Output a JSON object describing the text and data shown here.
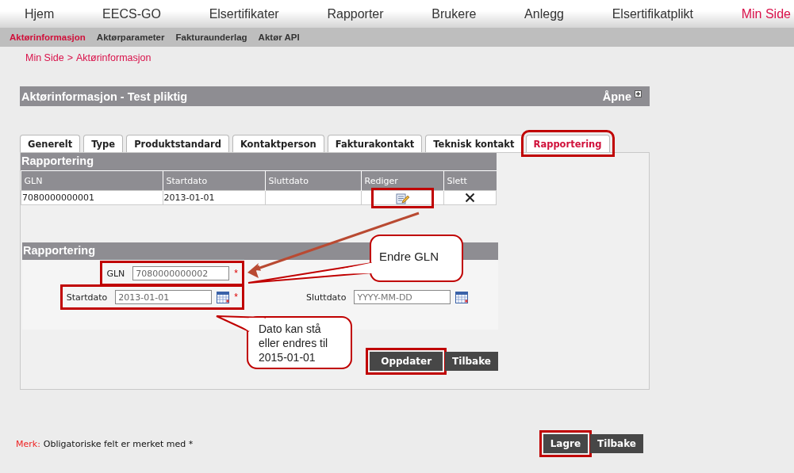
{
  "top_nav": [
    {
      "label": "Hjem",
      "selected": false
    },
    {
      "label": "EECS-GO",
      "selected": false
    },
    {
      "label": "Elsertifikater",
      "selected": false
    },
    {
      "label": "Rapporter",
      "selected": false
    },
    {
      "label": "Brukere",
      "selected": false
    },
    {
      "label": "Anlegg",
      "selected": false
    },
    {
      "label": "Elsertifikatplikt",
      "selected": false
    },
    {
      "label": "Min Side",
      "selected": true
    }
  ],
  "sub_nav": [
    {
      "label": "Aktørinformasjon",
      "selected": true
    },
    {
      "label": "Aktørparameter",
      "selected": false
    },
    {
      "label": "Fakturaunderlag",
      "selected": false
    },
    {
      "label": "Aktør API",
      "selected": false
    }
  ],
  "breadcrumb": {
    "items": [
      "Min Side",
      "Aktørinformasjon"
    ],
    "separator": ">"
  },
  "panel": {
    "title": "Aktørinformasjon - Test pliktig",
    "open_label": "Åpne"
  },
  "tabs": [
    {
      "label": "Generelt",
      "selected": false,
      "highlighted": false
    },
    {
      "label": "Type",
      "selected": false,
      "highlighted": false
    },
    {
      "label": "Produktstandard",
      "selected": false,
      "highlighted": false
    },
    {
      "label": "Kontaktperson",
      "selected": false,
      "highlighted": false
    },
    {
      "label": "Fakturakontakt",
      "selected": false,
      "highlighted": false
    },
    {
      "label": "Teknisk kontakt",
      "selected": false,
      "highlighted": false
    },
    {
      "label": "Rapportering",
      "selected": true,
      "highlighted": true
    }
  ],
  "report_table": {
    "title": "Rapportering",
    "columns": [
      "GLN",
      "Startdato",
      "Sluttdato",
      "Rediger",
      "Slett"
    ],
    "rows": [
      {
        "cells": [
          "7080000000001",
          "2013-01-01"
        ],
        "edit_highlighted": true
      }
    ]
  },
  "form": {
    "title": "Rapportering",
    "rows": [
      [
        {
          "label": "GLN",
          "value": "7080000000002",
          "required_mark": "*",
          "highlighted": true
        }
      ],
      [
        {
          "label": "Startdato",
          "value": "2013-01-01",
          "required_mark": "*",
          "calendar": true,
          "highlighted": true
        },
        {
          "label": "Sluttdato",
          "placeholder": "YYYY-MM-DD",
          "calendar": true,
          "highlighted": false
        }
      ]
    ],
    "buttons": [
      {
        "label": "Oppdater",
        "highlighted": true
      },
      {
        "label": "Tilbake",
        "highlighted": false
      }
    ]
  },
  "callouts": [
    {
      "text": "Endre GLN"
    },
    {
      "text": "Dato kan stå eller endres til 2015-01-01"
    }
  ],
  "footer": {
    "note_label": "Merk:",
    "note_text": "Obligatoriske felt er merket med *",
    "buttons": [
      {
        "label": "Lagre",
        "highlighted": true
      },
      {
        "label": "Tilbake",
        "highlighted": false
      }
    ]
  }
}
